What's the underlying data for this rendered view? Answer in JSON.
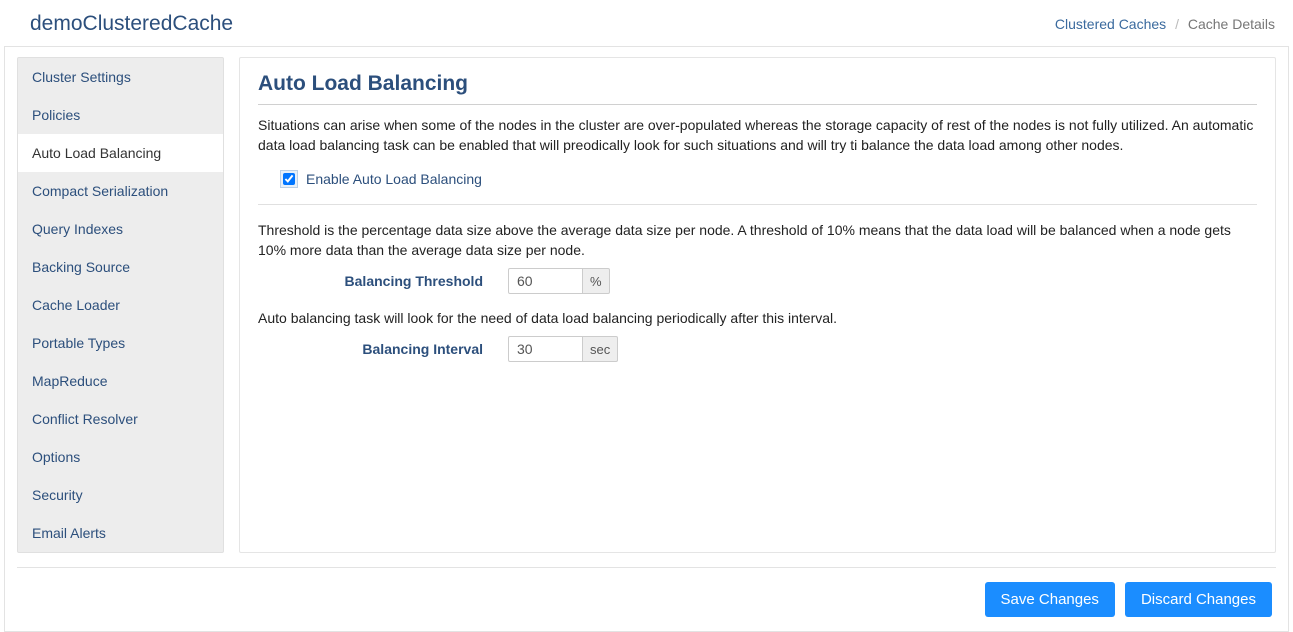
{
  "header": {
    "title": "demoClusteredCache"
  },
  "breadcrumb": {
    "parent": "Clustered Caches",
    "current": "Cache Details"
  },
  "sidebar": {
    "items": [
      {
        "label": "Cluster Settings"
      },
      {
        "label": "Policies"
      },
      {
        "label": "Auto Load Balancing"
      },
      {
        "label": "Compact Serialization"
      },
      {
        "label": "Query Indexes"
      },
      {
        "label": "Backing Source"
      },
      {
        "label": "Cache Loader"
      },
      {
        "label": "Portable Types"
      },
      {
        "label": "MapReduce"
      },
      {
        "label": "Conflict Resolver"
      },
      {
        "label": "Options"
      },
      {
        "label": "Security"
      },
      {
        "label": "Email Alerts"
      }
    ],
    "activeIndex": 2
  },
  "content": {
    "heading": "Auto Load Balancing",
    "intro": "Situations can arise when some of the nodes in the cluster are over-populated whereas the storage capacity of rest of the nodes is not fully utilized. An automatic data load balancing task can be enabled that will preodically look for such situations and will try ti balance the data load among other nodes.",
    "enable_label": "Enable Auto Load Balancing",
    "enable_checked": true,
    "threshold_desc": "Threshold is the percentage data size above the average data size per node. A threshold of 10% means that the data load will be balanced when a node gets 10% more data than the average data size per node.",
    "threshold_label": "Balancing Threshold",
    "threshold_value": "60",
    "threshold_unit": "%",
    "interval_desc": "Auto balancing task will look for the need of data load balancing periodically after this interval.",
    "interval_label": "Balancing Interval",
    "interval_value": "30",
    "interval_unit": "sec"
  },
  "buttons": {
    "save": "Save Changes",
    "discard": "Discard Changes"
  }
}
